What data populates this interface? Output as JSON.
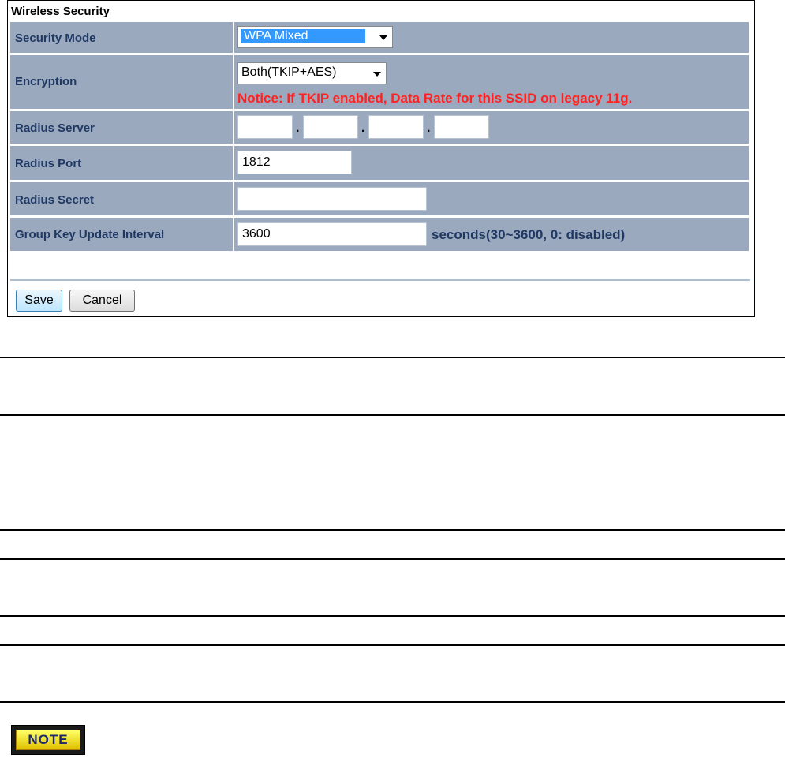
{
  "panel": {
    "title": "Wireless Security"
  },
  "fields": {
    "security_mode": {
      "label": "Security Mode",
      "value": "WPA Mixed"
    },
    "encryption": {
      "label": "Encryption",
      "value": "Both(TKIP+AES)",
      "notice": "Notice: If TKIP enabled, Data Rate for this SSID on legacy 11g."
    },
    "radius_server": {
      "label": "Radius Server",
      "octets": [
        "",
        "",
        "",
        ""
      ],
      "separator": "."
    },
    "radius_port": {
      "label": "Radius Port",
      "value": "1812"
    },
    "radius_secret": {
      "label": "Radius Secret",
      "value": ""
    },
    "group_key_interval": {
      "label": "Group Key Update Interval",
      "value": "3600",
      "suffix": "seconds(30~3600, 0: disabled)"
    }
  },
  "buttons": {
    "save": "Save",
    "cancel": "Cancel"
  },
  "note": {
    "badge": "NOTE"
  },
  "colors": {
    "row_bg": "#9aa9bd",
    "label_text": "#1f3864",
    "notice_text": "#ff2020",
    "selection": "#3399ff"
  }
}
